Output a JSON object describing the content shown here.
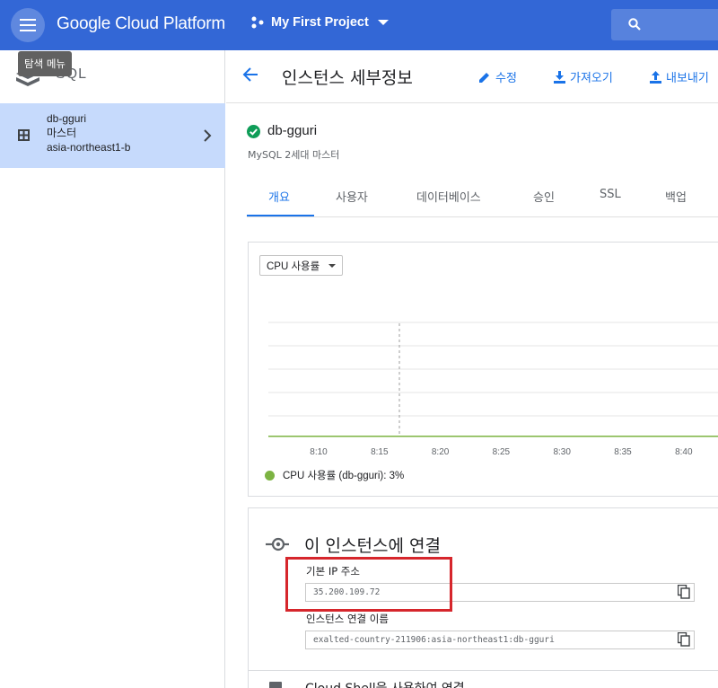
{
  "topbar": {
    "app_title": "Google Cloud Platform",
    "project": "My First Project",
    "menu_tooltip": "탐색 메뉴",
    "accent": "#3367d6"
  },
  "left": {
    "section_label": "SQL",
    "instance": {
      "name": "db-gguri",
      "role": "마스터",
      "region": "asia-northeast1-b"
    }
  },
  "header": {
    "title": "인스턴스 세부정보",
    "edit_label": "수정",
    "import_label": "가져오기",
    "export_label": "내보내기"
  },
  "instance": {
    "name": "db-gguri",
    "subtitle": "MySQL 2세대 마스터",
    "status_color": "#0f9d58"
  },
  "tabs": [
    "개요",
    "사용자",
    "데이터베이스",
    "승인",
    "SSL",
    "백업"
  ],
  "chart": {
    "metric": "CPU 사용률",
    "legend": "CPU 사용률 (db-gguri): 3%",
    "series_color": "#7cb342"
  },
  "chart_data": {
    "type": "line",
    "x": [
      "8:10",
      "8:15",
      "8:20",
      "8:25",
      "8:30",
      "8:35",
      "8:40"
    ],
    "series": [
      {
        "name": "CPU 사용률 (db-gguri)",
        "values": [
          3,
          3,
          3,
          3,
          3,
          3,
          3
        ]
      }
    ],
    "title": "",
    "xlabel": "",
    "ylabel": "",
    "grid": true,
    "legend": "bottom-left"
  },
  "connect": {
    "title": "이 인스턴스에 연결",
    "ip_label": "기본 IP 주소",
    "ip_value": "35.200.109.72",
    "conn_name_label": "인스턴스 연결 이름",
    "conn_name_value": "exalted-country-211906:asia-northeast1:db-gguri",
    "next_section": "Cloud Shell을 사용하여 연결"
  }
}
